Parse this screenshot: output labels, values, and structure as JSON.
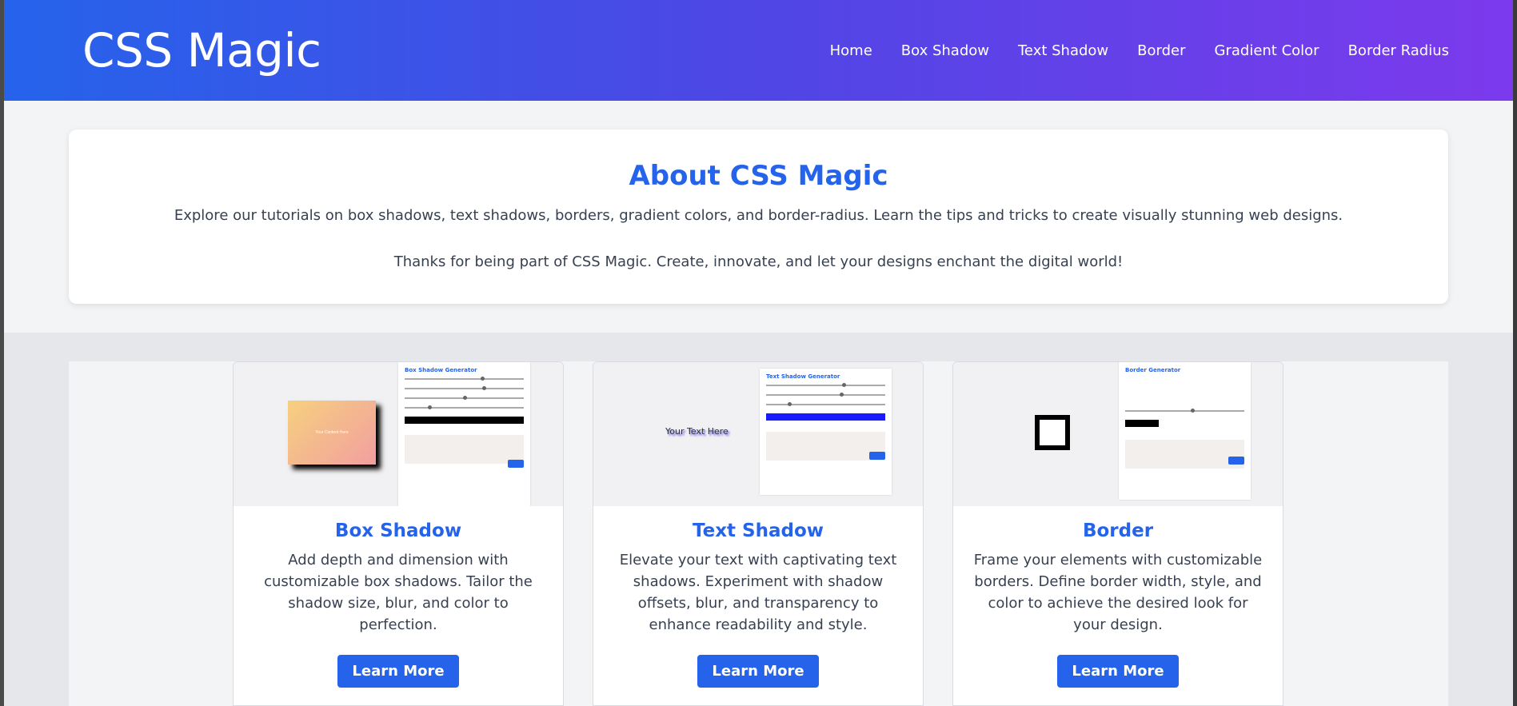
{
  "header": {
    "brand": "CSS Magic",
    "nav": [
      "Home",
      "Box Shadow",
      "Text Shadow",
      "Border",
      "Gradient Color",
      "Border Radius"
    ]
  },
  "about": {
    "title": "About CSS Magic",
    "p1": "Explore our tutorials on box shadows, text shadows, borders, gradient colors, and border-radius. Learn the tips and tricks to create visually stunning web designs.",
    "p2": "Thanks for being part of CSS Magic. Create, innovate, and let your designs enchant the digital world!"
  },
  "cards": [
    {
      "title": "Box Shadow",
      "desc": "Add depth and dimension with customizable box shadows. Tailor the shadow size, blur, and color to perfection.",
      "button": "Learn More",
      "thumb_panel_title": "Box Shadow Generator",
      "thumb_demo": "Your Content Here"
    },
    {
      "title": "Text Shadow",
      "desc": "Elevate your text with captivating text shadows. Experiment with shadow offsets, blur, and transparency to enhance readability and style.",
      "button": "Learn More",
      "thumb_panel_title": "Text Shadow Generator",
      "thumb_demo": "Your Text Here"
    },
    {
      "title": "Border",
      "desc": "Frame your elements with customizable borders. Define border width, style, and color to achieve the desired look for your design.",
      "button": "Learn More",
      "thumb_panel_title": "Border Generator",
      "thumb_demo": ""
    }
  ],
  "colors": {
    "accent": "#2563eb",
    "header_gradient_start": "#2563eb",
    "header_gradient_end": "#7c3aed"
  }
}
